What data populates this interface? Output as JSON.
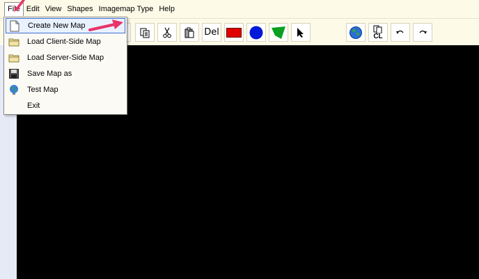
{
  "menubar": {
    "items": [
      "File",
      "Edit",
      "View",
      "Shapes",
      "Imagemap Type",
      "Help"
    ]
  },
  "toolbar": {
    "delete_label": "Del",
    "clipboard_label": "CL"
  },
  "file_menu": {
    "items": [
      {
        "label": "Create New Map",
        "icon": "new-document-icon"
      },
      {
        "label": "Load Client-Side Map",
        "icon": "folder-icon"
      },
      {
        "label": "Load Server-Side Map",
        "icon": "folder-icon"
      },
      {
        "label": "Save Map as",
        "icon": "floppy-disk-icon"
      },
      {
        "label": "Test Map",
        "icon": "globe-icon"
      },
      {
        "label": "Exit",
        "icon": ""
      }
    ]
  },
  "colors": {
    "menubar_bg": "#fdfbe8",
    "canvas_bg": "#000000",
    "left_strip": "#e6eaf7",
    "annotation_arrow": "#e8336a",
    "rect_shape": "#e00000",
    "circle_shape": "#0018d8",
    "polygon_shape": "#0aa020"
  }
}
